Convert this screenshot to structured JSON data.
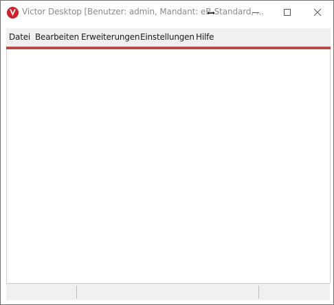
{
  "window": {
    "title": "Victor Desktop [Benutzer: admin, Mandant: eB-Standard, ...",
    "controls": {
      "minimize_icon": "minimize-icon",
      "maximize_icon": "maximize-icon",
      "close_icon": "close-icon"
    }
  },
  "menu": {
    "items": [
      {
        "label": "Datei"
      },
      {
        "label": "Bearbeiten"
      },
      {
        "label": "Erweiterungen"
      },
      {
        "label": "Einstellungen"
      },
      {
        "label": "Hilfe"
      }
    ],
    "accent_color": "#b84a47"
  },
  "branding": {
    "logo_color": "#d01f27"
  },
  "statusbar": {
    "sections": [
      "",
      "",
      ""
    ]
  }
}
